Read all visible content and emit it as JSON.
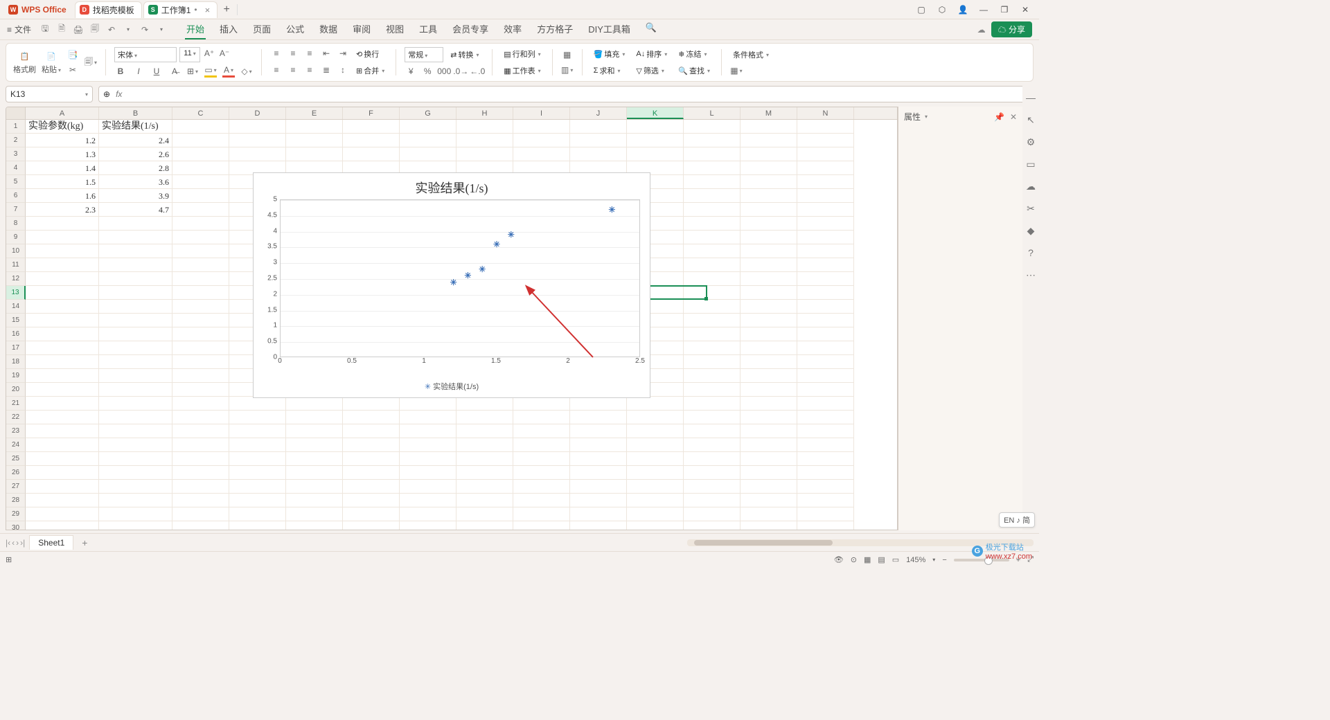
{
  "titlebar": {
    "brand": "WPS Office",
    "tab1": "找稻壳模板",
    "tab_workbook": "工作簿1",
    "tab_plus": "+"
  },
  "menu": {
    "file": "文件",
    "tabs": [
      "开始",
      "插入",
      "页面",
      "公式",
      "数据",
      "审阅",
      "视图",
      "工具",
      "会员专享",
      "效率",
      "方方格子",
      "DIY工具箱"
    ]
  },
  "ribbon": {
    "format_painter": "格式刷",
    "paste": "粘贴",
    "font_name": "宋体",
    "font_size": "11",
    "number_group": "常规",
    "transpose": "转换",
    "rowcol": "行和列",
    "worksheet": "工作表",
    "cond_fmt": "条件格式",
    "sum": "求和",
    "filter": "筛选",
    "fill": "填充",
    "sort": "排序",
    "freeze": "冻结",
    "find": "查找",
    "wrap": "换行",
    "merge": "合并"
  },
  "namebox": "K13",
  "panel": {
    "title": "属性"
  },
  "columns": [
    "A",
    "B",
    "C",
    "D",
    "E",
    "F",
    "G",
    "H",
    "I",
    "J",
    "K",
    "L",
    "M",
    "N"
  ],
  "sheet_data": {
    "headers": [
      "实验参数(kg)",
      "实验结果(1/s)"
    ],
    "rows": [
      [
        "1.2",
        "2.4"
      ],
      [
        "1.3",
        "2.6"
      ],
      [
        "1.4",
        "2.8"
      ],
      [
        "1.5",
        "3.6"
      ],
      [
        "1.6",
        "3.9"
      ],
      [
        "2.3",
        "4.7"
      ]
    ]
  },
  "chart_data": {
    "type": "scatter",
    "title": "实验结果(1/s)",
    "legend": "实验结果(1/s)",
    "xlabel": "",
    "ylabel": "",
    "xlim": [
      0,
      2.5
    ],
    "ylim": [
      0,
      5
    ],
    "xticks": [
      0,
      0.5,
      1,
      1.5,
      2,
      2.5
    ],
    "yticks": [
      0,
      0.5,
      1,
      1.5,
      2,
      2.5,
      3,
      3.5,
      4,
      4.5,
      5
    ],
    "x": [
      1.2,
      1.3,
      1.4,
      1.5,
      1.6,
      2.3
    ],
    "y": [
      2.4,
      2.6,
      2.8,
      3.6,
      3.9,
      4.7
    ]
  },
  "sheet_tab": "Sheet1",
  "status": {
    "zoom": "145%",
    "ime": "EN ♪ 简"
  },
  "share": "分享",
  "watermark": {
    "brand": "极光下载站",
    "url": "www.xz7.com"
  }
}
